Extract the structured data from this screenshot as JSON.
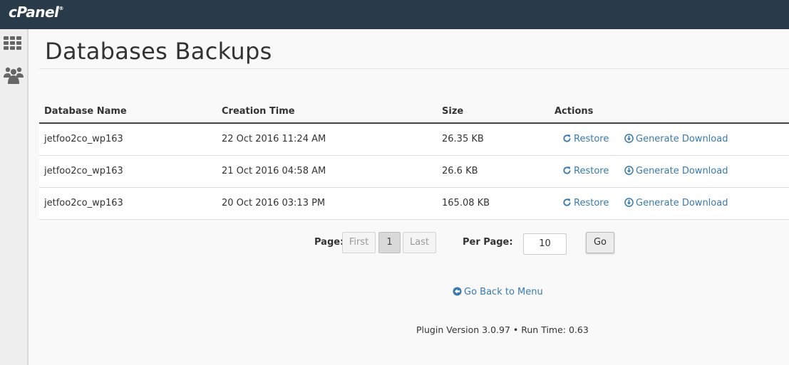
{
  "app": {
    "logo_text": "cPanel",
    "logo_mark": "®"
  },
  "page": {
    "title": "Databases Backups"
  },
  "table": {
    "headers": {
      "name": "Database Name",
      "time": "Creation Time",
      "size": "Size",
      "actions": "Actions"
    },
    "rows": [
      {
        "name": "jetfoo2co_wp163",
        "time": "22 Oct 2016 11:24 AM",
        "size": "26.35 KB",
        "restore": "Restore",
        "download": "Generate Download"
      },
      {
        "name": "jetfoo2co_wp163",
        "time": "21 Oct 2016 04:58 AM",
        "size": "26.6 KB",
        "restore": "Restore",
        "download": "Generate Download"
      },
      {
        "name": "jetfoo2co_wp163",
        "time": "20 Oct 2016 03:13 PM",
        "size": "165.08 KB",
        "restore": "Restore",
        "download": "Generate Download"
      }
    ]
  },
  "pagination": {
    "page_label": "Page:",
    "first": "First",
    "current": "1",
    "last": "Last",
    "per_page_label": "Per Page:",
    "per_page_value": "10",
    "go": "Go"
  },
  "links": {
    "back": "Go Back to Menu"
  },
  "footer": {
    "text": "Plugin Version 3.0.97 • Run Time: 0.63"
  },
  "colors": {
    "topbar": "#293a4a",
    "link": "#3a7ab0",
    "icon_gray": "#666666"
  },
  "icons": {
    "nav1": "grid-icon",
    "nav2": "users-icon",
    "restore": "refresh-icon",
    "download": "download-circle-icon",
    "back": "arrow-left-circle-icon"
  }
}
